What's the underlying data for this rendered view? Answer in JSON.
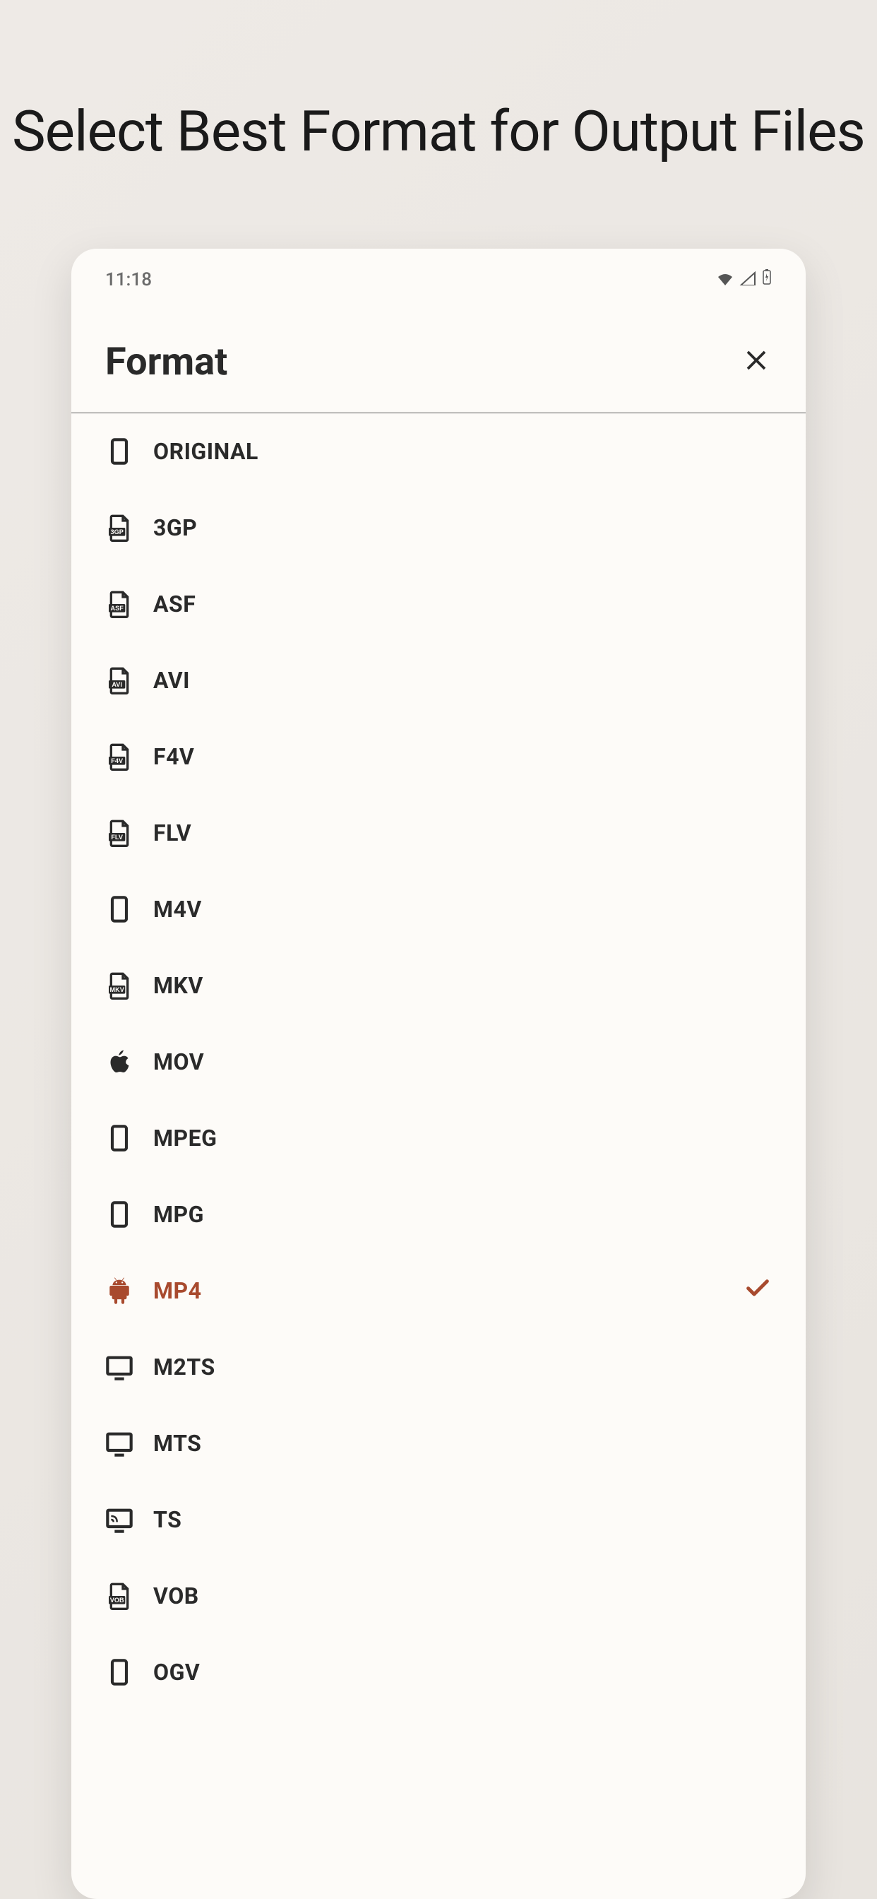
{
  "page": {
    "title": "Select Best Format for Output Files"
  },
  "statusBar": {
    "time": "11:18"
  },
  "screen": {
    "title": "Format"
  },
  "formats": [
    {
      "id": "original",
      "label": "ORIGINAL",
      "icon": "phone",
      "selected": false
    },
    {
      "id": "3gp",
      "label": "3GP",
      "icon": "file-3gp",
      "selected": false
    },
    {
      "id": "asf",
      "label": "ASF",
      "icon": "file-asf",
      "selected": false
    },
    {
      "id": "avi",
      "label": "AVI",
      "icon": "file-avi",
      "selected": false
    },
    {
      "id": "f4v",
      "label": "F4V",
      "icon": "file-f4v",
      "selected": false
    },
    {
      "id": "flv",
      "label": "FLV",
      "icon": "file-flv",
      "selected": false
    },
    {
      "id": "m4v",
      "label": "M4V",
      "icon": "phone",
      "selected": false
    },
    {
      "id": "mkv",
      "label": "MKV",
      "icon": "file-mkv",
      "selected": false
    },
    {
      "id": "mov",
      "label": "MOV",
      "icon": "apple",
      "selected": false
    },
    {
      "id": "mpeg",
      "label": "MPEG",
      "icon": "phone",
      "selected": false
    },
    {
      "id": "mpg",
      "label": "MPG",
      "icon": "phone",
      "selected": false
    },
    {
      "id": "mp4",
      "label": "MP4",
      "icon": "android",
      "selected": true
    },
    {
      "id": "m2ts",
      "label": "M2TS",
      "icon": "monitor",
      "selected": false
    },
    {
      "id": "mts",
      "label": "MTS",
      "icon": "monitor",
      "selected": false
    },
    {
      "id": "ts",
      "label": "TS",
      "icon": "cast",
      "selected": false
    },
    {
      "id": "vob",
      "label": "VOB",
      "icon": "file-vob",
      "selected": false
    },
    {
      "id": "ogv",
      "label": "OGV",
      "icon": "phone",
      "selected": false
    }
  ],
  "colors": {
    "accent": "#a84a2e",
    "text": "#2a2a2a",
    "background": "#fdfbf8"
  }
}
